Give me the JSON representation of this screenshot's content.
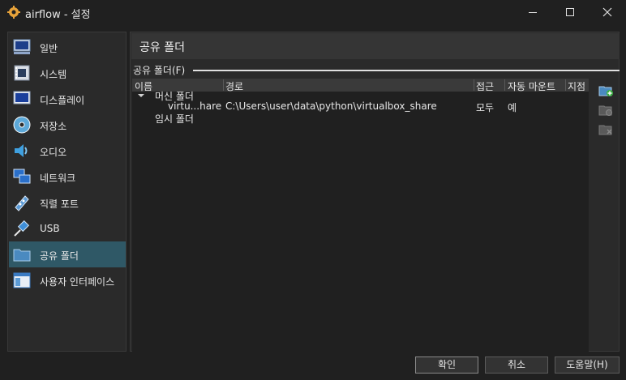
{
  "window": {
    "title": "airflow - 설정",
    "icon": "gear-icon",
    "controls": [
      "minimize-icon",
      "maximize-icon",
      "close-icon"
    ]
  },
  "sidebar": {
    "items": [
      {
        "label": "일반",
        "icon": "monitor-icon"
      },
      {
        "label": "시스템",
        "icon": "chip-icon"
      },
      {
        "label": "디스플레이",
        "icon": "display-icon"
      },
      {
        "label": "저장소",
        "icon": "disc-icon"
      },
      {
        "label": "오디오",
        "icon": "speaker-icon"
      },
      {
        "label": "네트워크",
        "icon": "network-icon"
      },
      {
        "label": "직렬 포트",
        "icon": "serial-port-icon"
      },
      {
        "label": "USB",
        "icon": "usb-icon"
      },
      {
        "label": "공유 폴더",
        "icon": "folder-icon",
        "selected": true
      },
      {
        "label": "사용자 인터페이스",
        "icon": "window-icon"
      }
    ]
  },
  "main": {
    "title": "공유 폴더",
    "group_label": "공유 폴더(F)",
    "table": {
      "columns": [
        "이름",
        "경로",
        "접근",
        "자동 마운트",
        "지점"
      ],
      "groups": [
        {
          "label": "머신 폴더",
          "expanded": true,
          "rows": [
            {
              "name": "virtu...hare",
              "path": "C:\\Users\\user\\data\\python\\virtualbox_share",
              "access": "모두",
              "automount": "예",
              "mountpoint": ""
            }
          ]
        },
        {
          "label": "임시 폴더",
          "expanded": false,
          "rows": []
        }
      ]
    },
    "tools": [
      "add-folder-icon",
      "edit-folder-icon",
      "remove-folder-icon"
    ]
  },
  "buttons": {
    "ok": "확인",
    "cancel": "취소",
    "help": "도움말(H)"
  },
  "colors": {
    "background": "#202020",
    "panel": "#2a2a2a",
    "selection": "#2f5866",
    "header": "#353535"
  }
}
